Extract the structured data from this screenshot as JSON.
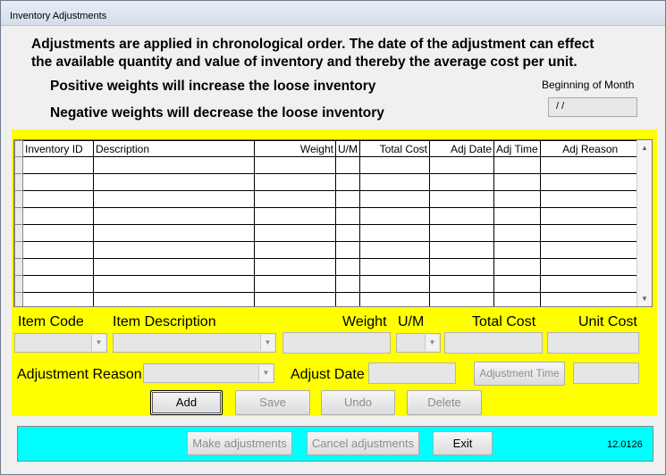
{
  "window": {
    "title": "Inventory Adjustments"
  },
  "info": {
    "line1": "Adjustments are applied in chronological order.  The date of the adjustment can effect",
    "line2": "the available quantity and value of inventory and thereby the average cost per unit.",
    "positive": "Positive weights will increase the loose inventory",
    "negative": "Negative weights will decrease the loose inventory"
  },
  "beginning_of_month": {
    "label": "Beginning of Month",
    "value": " / /"
  },
  "grid": {
    "columns": [
      "Inventory ID",
      "Description",
      "Weight",
      "U/M",
      "Total Cost",
      "Adj Date",
      "Adj Time",
      "Adj Reason"
    ],
    "row_count": 9
  },
  "form": {
    "item_code_label": "Item Code",
    "item_description_label": "Item Description",
    "weight_label": "Weight",
    "um_label": "U/M",
    "total_cost_label": "Total Cost",
    "unit_cost_label": "Unit Cost",
    "adjustment_reason_label": "Adjustment Reason",
    "adjust_date_label": "Adjust Date",
    "adjustment_time_button": "Adjustment Time"
  },
  "actions": {
    "add": "Add",
    "save": "Save",
    "undo": "Undo",
    "delete": "Delete"
  },
  "footer": {
    "make_adjustments": "Make adjustments",
    "cancel_adjustments": "Cancel adjustments",
    "exit": "Exit",
    "version": "12.0126"
  },
  "colors": {
    "form_panel": "#ffff00",
    "footer_panel": "#00ffff"
  }
}
